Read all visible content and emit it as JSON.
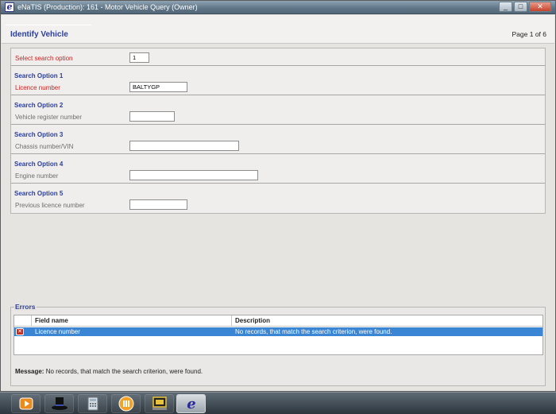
{
  "window": {
    "title": "eNaTIS (Production): 161 - Motor Vehicle Query (Owner)",
    "min_symbol": "_",
    "max_symbol": "□",
    "close_symbol": "✕"
  },
  "header": {
    "title": "Identify Vehicle",
    "page": "Page 1 of 6"
  },
  "form": {
    "select_option_label": "Select search option",
    "select_option_value": "1",
    "options": [
      {
        "title": "Search Option 1",
        "label": "Licence number",
        "value": "BALTYGP"
      },
      {
        "title": "Search Option 2",
        "label": "Vehicle register number",
        "value": ""
      },
      {
        "title": "Search Option 3",
        "label": "Chassis number/VIN",
        "value": ""
      },
      {
        "title": "Search Option 4",
        "label": "Engine number",
        "value": ""
      },
      {
        "title": "Search Option 5",
        "label": "Previous licence number",
        "value": ""
      }
    ]
  },
  "errors": {
    "group_label": "Errors",
    "columns": [
      "Field name",
      "Description"
    ],
    "rows": [
      {
        "field": "Licence number",
        "description": "No records, that match the search criterion, were found."
      }
    ],
    "message_label": "Message:",
    "message_text": "No records, that match the search criterion, were found."
  },
  "colors": {
    "accent_blue": "#2c3f9a",
    "required_red": "#cc2222",
    "selection_blue": "#3a86d4"
  },
  "taskbar": {
    "apps": [
      {
        "icon": "media-player-icon"
      },
      {
        "icon": "hat-icon"
      },
      {
        "icon": "calculator-icon"
      },
      {
        "icon": "orange-app-icon"
      },
      {
        "icon": "terminal-icon"
      },
      {
        "icon": "enatis-e-icon",
        "active": true
      }
    ]
  }
}
